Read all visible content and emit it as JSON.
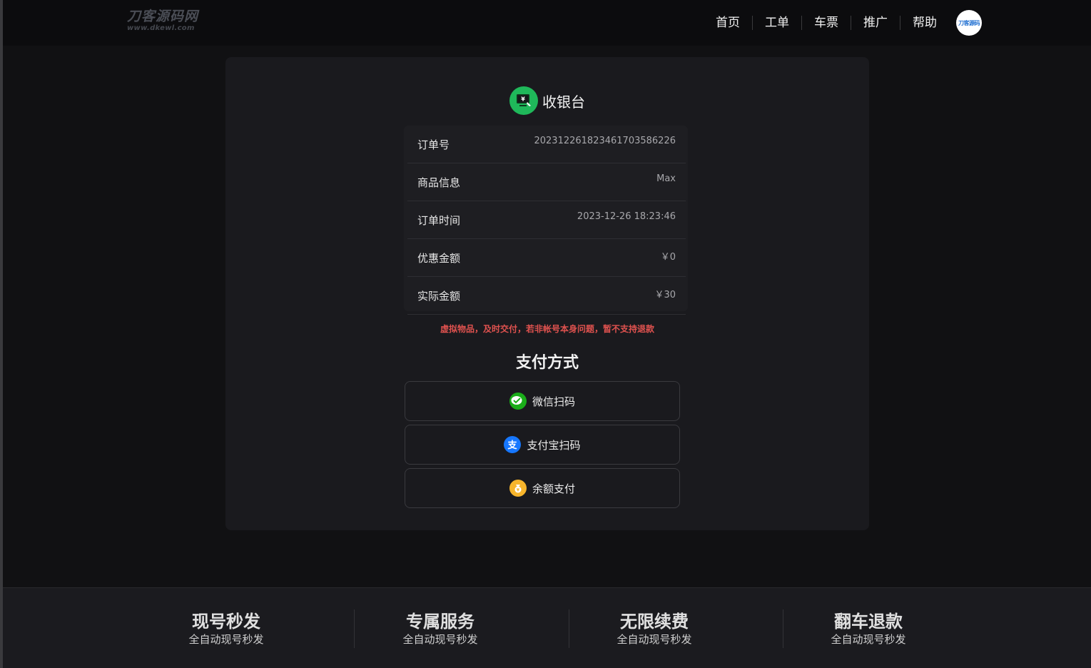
{
  "header": {
    "logo_main": "刀客源码网",
    "logo_sub": "www.dkewl.com",
    "nav": [
      "首页",
      "工单",
      "车票",
      "推广",
      "帮助"
    ],
    "avatar_text": "刀客源码"
  },
  "cashier": {
    "title": "收银台",
    "icon": "cashier-screen-icon",
    "rows": [
      {
        "label": "订单号",
        "value": "20231226182346170358622​6"
      },
      {
        "label": "商品信息",
        "value": "Max"
      },
      {
        "label": "订单时间",
        "value": "2023-12-26 18:23:46"
      },
      {
        "label": "优惠金额",
        "value": "￥0"
      },
      {
        "label": "实际金额",
        "value": "￥30"
      }
    ],
    "notice": "虚拟物品，及时交付，若非帐号本身问题，暂不支持退款",
    "pay_title": "支付方式",
    "pay_methods": [
      {
        "label": "微信扫码",
        "icon": "wechat-icon",
        "color": "#1aad19"
      },
      {
        "label": "支付宝扫码",
        "icon": "alipay-icon",
        "color": "#1677ff"
      },
      {
        "label": "余额支付",
        "icon": "wallet-icon",
        "color": "#f7b52c"
      }
    ]
  },
  "footer": {
    "features": [
      {
        "title": "现号秒发",
        "sub": "全自动现号秒发"
      },
      {
        "title": "专属服务",
        "sub": "全自动现号秒发"
      },
      {
        "title": "无限续费",
        "sub": "全自动现号秒发"
      },
      {
        "title": "翻车退款",
        "sub": "全自动现号秒发"
      }
    ]
  },
  "colors": {
    "accent_green": "#1fb85a",
    "notice_red": "#e0524f",
    "background": "#111113",
    "card": "#1a1a1e"
  }
}
